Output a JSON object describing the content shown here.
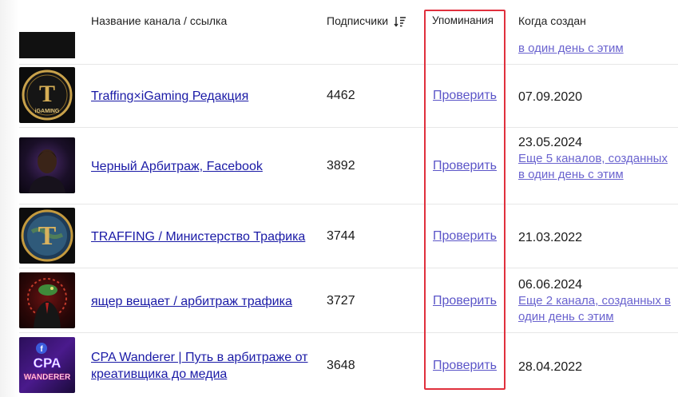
{
  "header": {
    "col_name": "Название канала / ссылка",
    "col_subscribers": "Подписчики",
    "col_mentions": "Упоминания",
    "col_created": "Когда создан"
  },
  "top_partial": {
    "created_link": "в один день с этим"
  },
  "rows": [
    {
      "name": "Traffing×iGaming Редакция",
      "subscribers": "4462",
      "check": "Проверить",
      "date": "07.09.2020",
      "more": ""
    },
    {
      "name": "Черный Арбитраж, Facebook",
      "subscribers": "3892",
      "check": "Проверить",
      "date": "23.05.2024",
      "more": "Еще 5 каналов, созданных в один день с этим"
    },
    {
      "name": "TRAFFING / Министерство Трафика",
      "subscribers": "3744",
      "check": "Проверить",
      "date": "21.03.2022",
      "more": ""
    },
    {
      "name": "ящер вещает / арбитраж трафика",
      "subscribers": "3727",
      "check": "Проверить",
      "date": "06.06.2024",
      "more": "Еще 2 канала, созданных в один день с этим"
    },
    {
      "name": "CPA Wanderer | Путь в арбитраже от креативщика до медиа",
      "subscribers": "3648",
      "check": "Проверить",
      "date": "28.04.2022",
      "more": ""
    }
  ],
  "thumb_texts": {
    "row0_letter": "T",
    "row0_word": "iGAMING",
    "row2_letter": "T",
    "row4_top": "CPA",
    "row4_bottom": "WANDERER"
  },
  "colors": {
    "highlight": "#e0303d",
    "link": "#1a1aa6",
    "check_link": "#5b55c8",
    "more_link": "#6a63cf"
  }
}
